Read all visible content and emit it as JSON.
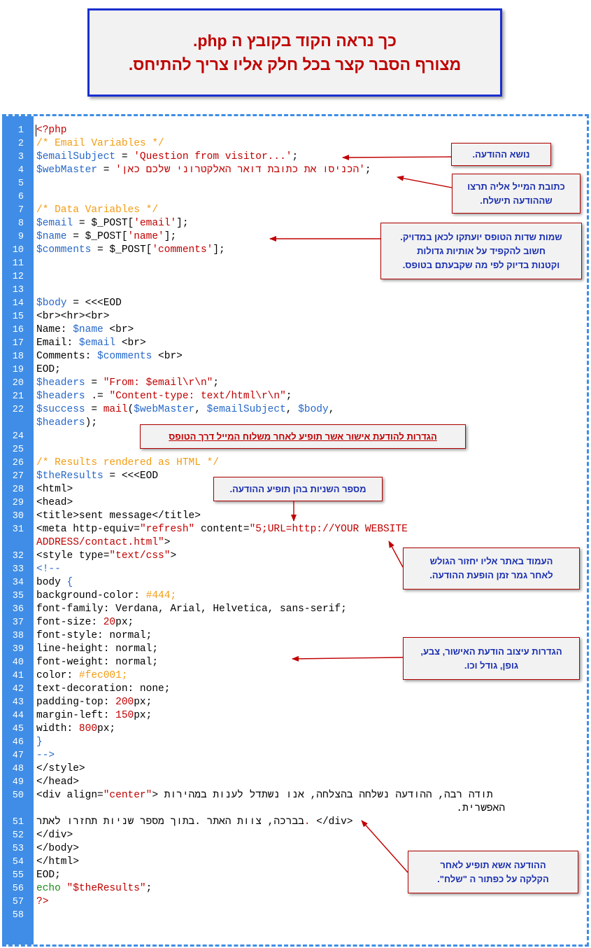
{
  "header": {
    "line1": "כך נראה הקוד בקובץ ה php.",
    "line2": "מצורף הסבר קצר בכל חלק אליו צריך להתיחס."
  },
  "code_lines": [
    {
      "n": "1",
      "parts": [
        {
          "t": "<?php",
          "c": "k"
        }
      ]
    },
    {
      "n": "2",
      "parts": [
        {
          "t": "/* Email Variables */",
          "c": "c"
        }
      ]
    },
    {
      "n": "3",
      "parts": [
        {
          "t": "$emailSubject",
          "c": "v"
        },
        {
          "t": " = "
        },
        {
          "t": "'Question from visitor...'",
          "c": "s"
        },
        {
          "t": ";"
        }
      ]
    },
    {
      "n": "4",
      "parts": [
        {
          "t": "$webMaster",
          "c": "v"
        },
        {
          "t": " = "
        },
        {
          "t": "'הכניסו את כתובת דואר האלקטרוני שלכם כאן'",
          "c": "s"
        },
        {
          "t": ";"
        }
      ]
    },
    {
      "n": "5",
      "parts": []
    },
    {
      "n": "6",
      "parts": []
    },
    {
      "n": "7",
      "parts": [
        {
          "t": "/* Data Variables */",
          "c": "c"
        }
      ]
    },
    {
      "n": "8",
      "parts": [
        {
          "t": "$email",
          "c": "v"
        },
        {
          "t": " = $_POST["
        },
        {
          "t": "'email'",
          "c": "s"
        },
        {
          "t": "];"
        }
      ]
    },
    {
      "n": "9",
      "parts": [
        {
          "t": "$name",
          "c": "v"
        },
        {
          "t": " = $_POST["
        },
        {
          "t": "'name'",
          "c": "s"
        },
        {
          "t": "];"
        }
      ]
    },
    {
      "n": "10",
      "parts": [
        {
          "t": "$comments",
          "c": "v"
        },
        {
          "t": " = $_POST["
        },
        {
          "t": "'comments'",
          "c": "s"
        },
        {
          "t": "];"
        }
      ]
    },
    {
      "n": "11",
      "parts": []
    },
    {
      "n": "12",
      "parts": []
    },
    {
      "n": "13",
      "parts": []
    },
    {
      "n": "14",
      "parts": [
        {
          "t": "$body",
          "c": "v"
        },
        {
          "t": " = <<<EOD"
        }
      ]
    },
    {
      "n": "15",
      "parts": [
        {
          "t": "<br><hr><br>"
        }
      ]
    },
    {
      "n": "16",
      "parts": [
        {
          "t": "Name: "
        },
        {
          "t": "$name",
          "c": "v"
        },
        {
          "t": " <br>"
        }
      ]
    },
    {
      "n": "17",
      "parts": [
        {
          "t": "Email: "
        },
        {
          "t": "$email",
          "c": "v"
        },
        {
          "t": " <br>"
        }
      ]
    },
    {
      "n": "18",
      "parts": [
        {
          "t": "Comments: "
        },
        {
          "t": "$comments",
          "c": "v"
        },
        {
          "t": " <br>"
        }
      ]
    },
    {
      "n": "19",
      "parts": [
        {
          "t": "EOD;"
        }
      ]
    },
    {
      "n": "20",
      "parts": [
        {
          "t": "$headers",
          "c": "v"
        },
        {
          "t": " = "
        },
        {
          "t": "\"From: $email\\r\\n\"",
          "c": "s"
        },
        {
          "t": ";"
        }
      ]
    },
    {
      "n": "21",
      "parts": [
        {
          "t": "$headers",
          "c": "v"
        },
        {
          "t": " .= "
        },
        {
          "t": "\"Content-type: text/html\\r\\n\"",
          "c": "s"
        },
        {
          "t": ";"
        }
      ]
    },
    {
      "n": "22",
      "parts": [
        {
          "t": "$success",
          "c": "v"
        },
        {
          "t": " = "
        },
        {
          "t": "mail",
          "c": "k"
        },
        {
          "t": "("
        },
        {
          "t": "$webMaster",
          "c": "v"
        },
        {
          "t": ", "
        },
        {
          "t": "$emailSubject",
          "c": "v"
        },
        {
          "t": ", "
        },
        {
          "t": "$body",
          "c": "v"
        },
        {
          "t": ","
        }
      ]
    },
    {
      "n": "",
      "parts": [
        {
          "t": "$headers",
          "c": "v"
        },
        {
          "t": ");"
        }
      ]
    },
    {
      "n": "24",
      "parts": []
    },
    {
      "n": "25",
      "parts": []
    },
    {
      "n": "26",
      "parts": [
        {
          "t": "/* Results rendered as HTML */",
          "c": "c"
        }
      ]
    },
    {
      "n": "27",
      "parts": [
        {
          "t": "$theResults",
          "c": "v"
        },
        {
          "t": " = <<<EOD"
        }
      ]
    },
    {
      "n": "28",
      "parts": [
        {
          "t": "<html>"
        }
      ]
    },
    {
      "n": "29",
      "parts": [
        {
          "t": "<head>"
        }
      ]
    },
    {
      "n": "30",
      "parts": [
        {
          "t": "<title>sent message</title>"
        }
      ]
    },
    {
      "n": "31",
      "parts": [
        {
          "t": "<meta http-equiv="
        },
        {
          "t": "\"refresh\"",
          "c": "s"
        },
        {
          "t": " content="
        },
        {
          "t": "\"5;URL=http://YOUR WEBSITE",
          "c": "s"
        }
      ]
    },
    {
      "n": "",
      "parts": [
        {
          "t": "ADDRESS/contact.html\"",
          "c": "s"
        },
        {
          "t": ">"
        }
      ]
    },
    {
      "n": "32",
      "parts": [
        {
          "t": "<style type="
        },
        {
          "t": "\"text/css\"",
          "c": "s"
        },
        {
          "t": ">"
        }
      ]
    },
    {
      "n": "33",
      "parts": [
        {
          "t": "<!--",
          "c": "v"
        }
      ]
    },
    {
      "n": "34",
      "parts": [
        {
          "t": "body "
        },
        {
          "t": "{",
          "c": "v"
        }
      ]
    },
    {
      "n": "35",
      "parts": [
        {
          "t": "background-color: "
        },
        {
          "t": "#444;",
          "c": "c"
        }
      ]
    },
    {
      "n": "36",
      "parts": [
        {
          "t": "font-family: Verdana, Arial, Helvetica, sans-serif;"
        }
      ]
    },
    {
      "n": "37",
      "parts": [
        {
          "t": "font-size: "
        },
        {
          "t": "20",
          "c": "n"
        },
        {
          "t": "px;"
        }
      ]
    },
    {
      "n": "38",
      "parts": [
        {
          "t": "font-style: normal;"
        }
      ]
    },
    {
      "n": "39",
      "parts": [
        {
          "t": "line-height: normal;"
        }
      ]
    },
    {
      "n": "40",
      "parts": [
        {
          "t": "font-weight: normal;"
        }
      ]
    },
    {
      "n": "41",
      "parts": [
        {
          "t": "color: "
        },
        {
          "t": "#fec001;",
          "c": "c"
        }
      ]
    },
    {
      "n": "42",
      "parts": [
        {
          "t": "text-decoration: none;"
        }
      ]
    },
    {
      "n": "43",
      "parts": [
        {
          "t": "padding-top: "
        },
        {
          "t": "200",
          "c": "n"
        },
        {
          "t": "px;"
        }
      ]
    },
    {
      "n": "44",
      "parts": [
        {
          "t": "margin-left: "
        },
        {
          "t": "150",
          "c": "n"
        },
        {
          "t": "px;"
        }
      ]
    },
    {
      "n": "45",
      "parts": [
        {
          "t": "width: "
        },
        {
          "t": "800",
          "c": "n"
        },
        {
          "t": "px;"
        }
      ]
    },
    {
      "n": "46",
      "parts": [
        {
          "t": "}",
          "c": "v"
        }
      ]
    },
    {
      "n": "47",
      "parts": [
        {
          "t": "-->",
          "c": "v"
        }
      ]
    },
    {
      "n": "48",
      "parts": [
        {
          "t": "</style>"
        }
      ]
    },
    {
      "n": "49",
      "parts": [
        {
          "t": "</head>"
        }
      ]
    },
    {
      "n": "50",
      "parts": [
        {
          "t": "<div align="
        },
        {
          "t": "\"center\"",
          "c": "s"
        },
        {
          "t": "> תודה רבה, ההודעה נשלחה בהצלחה, אנו נשתדל לענות במהירות"
        }
      ]
    },
    {
      "n": "",
      "parts": [
        {
          "t": "                                                                     .האפשרית"
        }
      ]
    },
    {
      "n": "51",
      "parts": [
        {
          "t": "בברכה, צוות האתר .בתוך מספר שניות תחזרו לאתר"
        },
        {
          "t": ".",
          "c": "s"
        },
        {
          "t": " </div>"
        }
      ]
    },
    {
      "n": "52",
      "parts": [
        {
          "t": "</div>"
        }
      ]
    },
    {
      "n": "53",
      "parts": [
        {
          "t": "</body>"
        }
      ]
    },
    {
      "n": "54",
      "parts": [
        {
          "t": "</html>"
        }
      ]
    },
    {
      "n": "55",
      "parts": [
        {
          "t": "EOD;"
        }
      ]
    },
    {
      "n": "56",
      "parts": [
        {
          "t": "echo ",
          "c": "e"
        },
        {
          "t": "\"$theResults\"",
          "c": "s"
        },
        {
          "t": ";"
        }
      ]
    },
    {
      "n": "57",
      "parts": [
        {
          "t": "?>",
          "c": "k"
        }
      ]
    },
    {
      "n": "58",
      "parts": []
    }
  ],
  "notes": {
    "subject": "נושא ההודעה.",
    "email_address": [
      "כתובת המייל אליה תרצו",
      "שההודעה תישלח."
    ],
    "form_fields": [
      "שמות שדות הטופס יועתקו לכאן במדויק.",
      "חשוב להקפיד על אותיות גדולות",
      "וקטנות בדיוק לפי מה שקבעתם בטופס."
    ],
    "confirmation_settings": "הגדרות להודעת אישור אשר תופיע לאחר משלוח המייל דרך הטופס",
    "seconds": "מספר השניות בהן תופיע ההודעה.",
    "return_page": [
      "העמוד באתר אליו יחזור הגולש",
      "לאחר גמר זמן הופעת ההודעה."
    ],
    "style": [
      "הגדרות עיצוב הודעת האישור, צבע,",
      "גופן, גודל וכו."
    ],
    "message": [
      "ההודעה אשא תופיע לאחר",
      "הקלקה על כפתור ה \"שלח\"."
    ]
  }
}
